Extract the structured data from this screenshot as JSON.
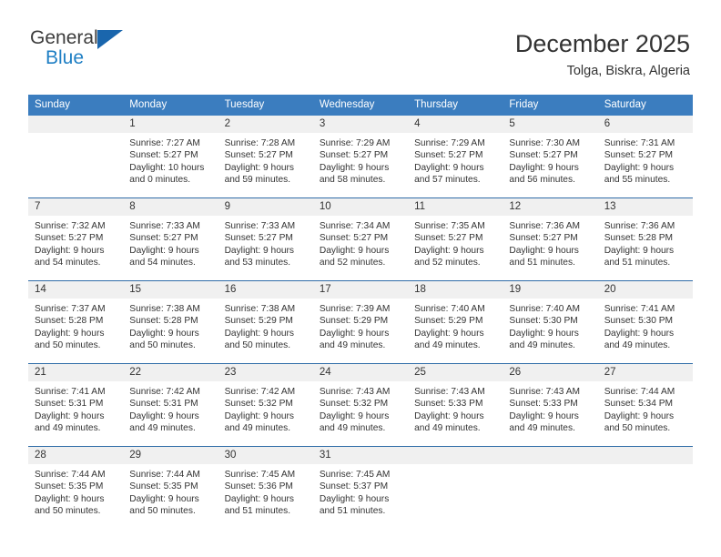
{
  "brand": {
    "name_part1": "General",
    "name_part2": "Blue",
    "triangle_color": "#1a66ad",
    "blue_color": "#1f7fc4"
  },
  "header": {
    "title": "December 2025",
    "subtitle": "Tolga, Biskra, Algeria"
  },
  "theme": {
    "header_bg": "#3b7dbf",
    "day_band_bg": "#f0f0f0",
    "week_divider": "#2f6ca8",
    "text": "#333333"
  },
  "weekday_headers": [
    "Sunday",
    "Monday",
    "Tuesday",
    "Wednesday",
    "Thursday",
    "Friday",
    "Saturday"
  ],
  "weeks": [
    [
      {
        "day": "",
        "lines": [],
        "empty": true
      },
      {
        "day": "1",
        "lines": [
          "Sunrise: 7:27 AM",
          "Sunset: 5:27 PM",
          "Daylight: 10 hours",
          "and 0 minutes."
        ]
      },
      {
        "day": "2",
        "lines": [
          "Sunrise: 7:28 AM",
          "Sunset: 5:27 PM",
          "Daylight: 9 hours",
          "and 59 minutes."
        ]
      },
      {
        "day": "3",
        "lines": [
          "Sunrise: 7:29 AM",
          "Sunset: 5:27 PM",
          "Daylight: 9 hours",
          "and 58 minutes."
        ]
      },
      {
        "day": "4",
        "lines": [
          "Sunrise: 7:29 AM",
          "Sunset: 5:27 PM",
          "Daylight: 9 hours",
          "and 57 minutes."
        ]
      },
      {
        "day": "5",
        "lines": [
          "Sunrise: 7:30 AM",
          "Sunset: 5:27 PM",
          "Daylight: 9 hours",
          "and 56 minutes."
        ]
      },
      {
        "day": "6",
        "lines": [
          "Sunrise: 7:31 AM",
          "Sunset: 5:27 PM",
          "Daylight: 9 hours",
          "and 55 minutes."
        ]
      }
    ],
    [
      {
        "day": "7",
        "lines": [
          "Sunrise: 7:32 AM",
          "Sunset: 5:27 PM",
          "Daylight: 9 hours",
          "and 54 minutes."
        ]
      },
      {
        "day": "8",
        "lines": [
          "Sunrise: 7:33 AM",
          "Sunset: 5:27 PM",
          "Daylight: 9 hours",
          "and 54 minutes."
        ]
      },
      {
        "day": "9",
        "lines": [
          "Sunrise: 7:33 AM",
          "Sunset: 5:27 PM",
          "Daylight: 9 hours",
          "and 53 minutes."
        ]
      },
      {
        "day": "10",
        "lines": [
          "Sunrise: 7:34 AM",
          "Sunset: 5:27 PM",
          "Daylight: 9 hours",
          "and 52 minutes."
        ]
      },
      {
        "day": "11",
        "lines": [
          "Sunrise: 7:35 AM",
          "Sunset: 5:27 PM",
          "Daylight: 9 hours",
          "and 52 minutes."
        ]
      },
      {
        "day": "12",
        "lines": [
          "Sunrise: 7:36 AM",
          "Sunset: 5:27 PM",
          "Daylight: 9 hours",
          "and 51 minutes."
        ]
      },
      {
        "day": "13",
        "lines": [
          "Sunrise: 7:36 AM",
          "Sunset: 5:28 PM",
          "Daylight: 9 hours",
          "and 51 minutes."
        ]
      }
    ],
    [
      {
        "day": "14",
        "lines": [
          "Sunrise: 7:37 AM",
          "Sunset: 5:28 PM",
          "Daylight: 9 hours",
          "and 50 minutes."
        ]
      },
      {
        "day": "15",
        "lines": [
          "Sunrise: 7:38 AM",
          "Sunset: 5:28 PM",
          "Daylight: 9 hours",
          "and 50 minutes."
        ]
      },
      {
        "day": "16",
        "lines": [
          "Sunrise: 7:38 AM",
          "Sunset: 5:29 PM",
          "Daylight: 9 hours",
          "and 50 minutes."
        ]
      },
      {
        "day": "17",
        "lines": [
          "Sunrise: 7:39 AM",
          "Sunset: 5:29 PM",
          "Daylight: 9 hours",
          "and 49 minutes."
        ]
      },
      {
        "day": "18",
        "lines": [
          "Sunrise: 7:40 AM",
          "Sunset: 5:29 PM",
          "Daylight: 9 hours",
          "and 49 minutes."
        ]
      },
      {
        "day": "19",
        "lines": [
          "Sunrise: 7:40 AM",
          "Sunset: 5:30 PM",
          "Daylight: 9 hours",
          "and 49 minutes."
        ]
      },
      {
        "day": "20",
        "lines": [
          "Sunrise: 7:41 AM",
          "Sunset: 5:30 PM",
          "Daylight: 9 hours",
          "and 49 minutes."
        ]
      }
    ],
    [
      {
        "day": "21",
        "lines": [
          "Sunrise: 7:41 AM",
          "Sunset: 5:31 PM",
          "Daylight: 9 hours",
          "and 49 minutes."
        ]
      },
      {
        "day": "22",
        "lines": [
          "Sunrise: 7:42 AM",
          "Sunset: 5:31 PM",
          "Daylight: 9 hours",
          "and 49 minutes."
        ]
      },
      {
        "day": "23",
        "lines": [
          "Sunrise: 7:42 AM",
          "Sunset: 5:32 PM",
          "Daylight: 9 hours",
          "and 49 minutes."
        ]
      },
      {
        "day": "24",
        "lines": [
          "Sunrise: 7:43 AM",
          "Sunset: 5:32 PM",
          "Daylight: 9 hours",
          "and 49 minutes."
        ]
      },
      {
        "day": "25",
        "lines": [
          "Sunrise: 7:43 AM",
          "Sunset: 5:33 PM",
          "Daylight: 9 hours",
          "and 49 minutes."
        ]
      },
      {
        "day": "26",
        "lines": [
          "Sunrise: 7:43 AM",
          "Sunset: 5:33 PM",
          "Daylight: 9 hours",
          "and 49 minutes."
        ]
      },
      {
        "day": "27",
        "lines": [
          "Sunrise: 7:44 AM",
          "Sunset: 5:34 PM",
          "Daylight: 9 hours",
          "and 50 minutes."
        ]
      }
    ],
    [
      {
        "day": "28",
        "lines": [
          "Sunrise: 7:44 AM",
          "Sunset: 5:35 PM",
          "Daylight: 9 hours",
          "and 50 minutes."
        ]
      },
      {
        "day": "29",
        "lines": [
          "Sunrise: 7:44 AM",
          "Sunset: 5:35 PM",
          "Daylight: 9 hours",
          "and 50 minutes."
        ]
      },
      {
        "day": "30",
        "lines": [
          "Sunrise: 7:45 AM",
          "Sunset: 5:36 PM",
          "Daylight: 9 hours",
          "and 51 minutes."
        ]
      },
      {
        "day": "31",
        "lines": [
          "Sunrise: 7:45 AM",
          "Sunset: 5:37 PM",
          "Daylight: 9 hours",
          "and 51 minutes."
        ]
      },
      {
        "day": "",
        "lines": [],
        "empty": true
      },
      {
        "day": "",
        "lines": [],
        "empty": true
      },
      {
        "day": "",
        "lines": [],
        "empty": true
      }
    ]
  ]
}
